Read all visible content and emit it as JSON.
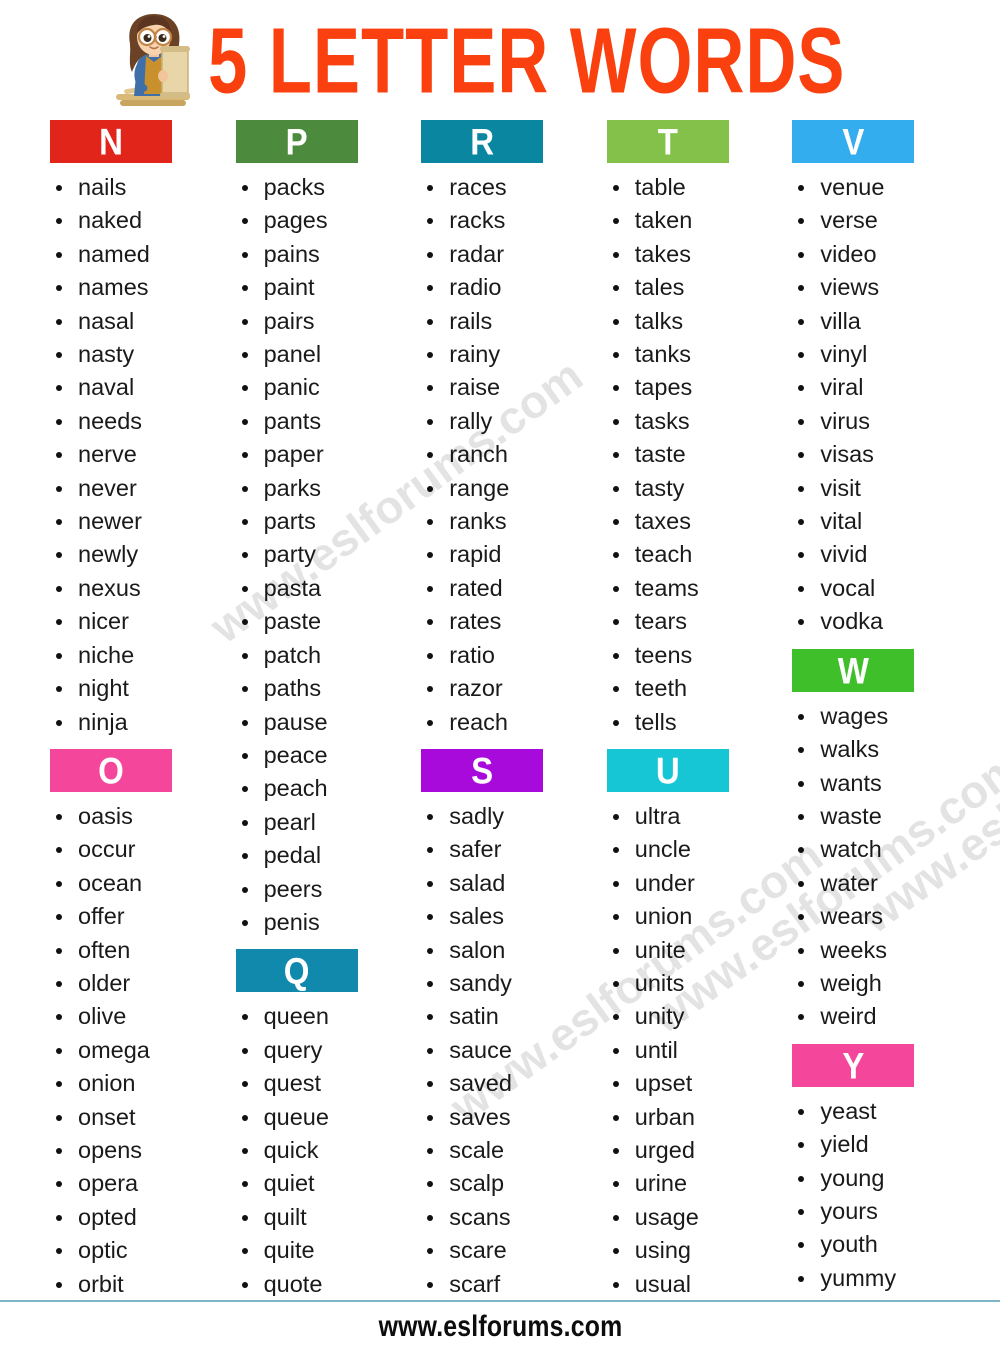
{
  "header": {
    "title": "5 LETTER WORDS",
    "mascot_alt": "girl-reading-scroll"
  },
  "watermark": {
    "text": "www.eslforums.com"
  },
  "footer": {
    "url": "www.eslforums.com"
  },
  "colors": {
    "title": "#F9400E",
    "N": "#E1251B",
    "O": "#F4479B",
    "P": "#4C8B3E",
    "Q": "#1189AC",
    "R": "#0A86A0",
    "S": "#A80ADB",
    "T": "#84C14A",
    "U": "#16C6D4",
    "V": "#34ADEE",
    "W": "#3FBF2A",
    "Y": "#F4479B",
    "footer_rule": "#7FB6C4"
  },
  "columns": [
    {
      "sections": [
        {
          "letter": "N",
          "color": "#E1251B",
          "words": [
            "nails",
            "naked",
            "named",
            "names",
            "nasal",
            "nasty",
            "naval",
            "needs",
            "nerve",
            "never",
            "newer",
            "newly",
            "nexus",
            "nicer",
            "niche",
            "night",
            "ninja"
          ]
        },
        {
          "letter": "O",
          "color": "#F4479B",
          "words": [
            "oasis",
            "occur",
            "ocean",
            "offer",
            "often",
            "older",
            "olive",
            "omega",
            "onion",
            "onset",
            "opens",
            "opera",
            "opted",
            "optic",
            "orbit"
          ]
        }
      ]
    },
    {
      "sections": [
        {
          "letter": "P",
          "color": "#4C8B3E",
          "words": [
            "packs",
            "pages",
            "pains",
            "paint",
            "pairs",
            "panel",
            "panic",
            "pants",
            "paper",
            "parks",
            "parts",
            "party",
            "pasta",
            "paste",
            "patch",
            "paths",
            "pause",
            "peace",
            "peach",
            "pearl",
            "pedal",
            "peers",
            "penis"
          ]
        },
        {
          "letter": "Q",
          "color": "#1189AC",
          "words": [
            "queen",
            "query",
            "quest",
            "queue",
            "quick",
            "quiet",
            "quilt",
            "quite",
            "quote"
          ]
        }
      ]
    },
    {
      "sections": [
        {
          "letter": "R",
          "color": "#0A86A0",
          "words": [
            "races",
            "racks",
            "radar",
            "radio",
            "rails",
            "rainy",
            "raise",
            "rally",
            "ranch",
            "range",
            "ranks",
            "rapid",
            "rated",
            "rates",
            "ratio",
            "razor",
            "reach"
          ]
        },
        {
          "letter": "S",
          "color": "#A80ADB",
          "words": [
            "sadly",
            "safer",
            "salad",
            "sales",
            "salon",
            "sandy",
            "satin",
            "sauce",
            "saved",
            "saves",
            "scale",
            "scalp",
            "scans",
            "scare",
            "scarf"
          ]
        }
      ]
    },
    {
      "sections": [
        {
          "letter": "T",
          "color": "#84C14A",
          "words": [
            "table",
            "taken",
            "takes",
            "tales",
            "talks",
            "tanks",
            "tapes",
            "tasks",
            "taste",
            "tasty",
            "taxes",
            "teach",
            "teams",
            "tears",
            "teens",
            "teeth",
            "tells"
          ]
        },
        {
          "letter": "U",
          "color": "#16C6D4",
          "words": [
            "ultra",
            "uncle",
            "under",
            "union",
            "unite",
            "units",
            "unity",
            "until",
            "upset",
            "urban",
            "urged",
            "urine",
            "usage",
            "using",
            "usual"
          ]
        }
      ]
    },
    {
      "sections": [
        {
          "letter": "V",
          "color": "#34ADEE",
          "words": [
            "venue",
            "verse",
            "video",
            "views",
            "villa",
            "vinyl",
            "viral",
            "virus",
            "visas",
            "visit",
            "vital",
            "vivid",
            "vocal",
            "vodka"
          ]
        },
        {
          "letter": "W",
          "color": "#3FBF2A",
          "words": [
            "wages",
            "walks",
            "wants",
            "waste",
            "watch",
            "water",
            "wears",
            "weeks",
            "weigh",
            "weird"
          ]
        },
        {
          "letter": "Y",
          "color": "#F4479B",
          "words": [
            "yeast",
            "yield",
            "young",
            "yours",
            "youth",
            "yummy"
          ]
        }
      ]
    }
  ]
}
